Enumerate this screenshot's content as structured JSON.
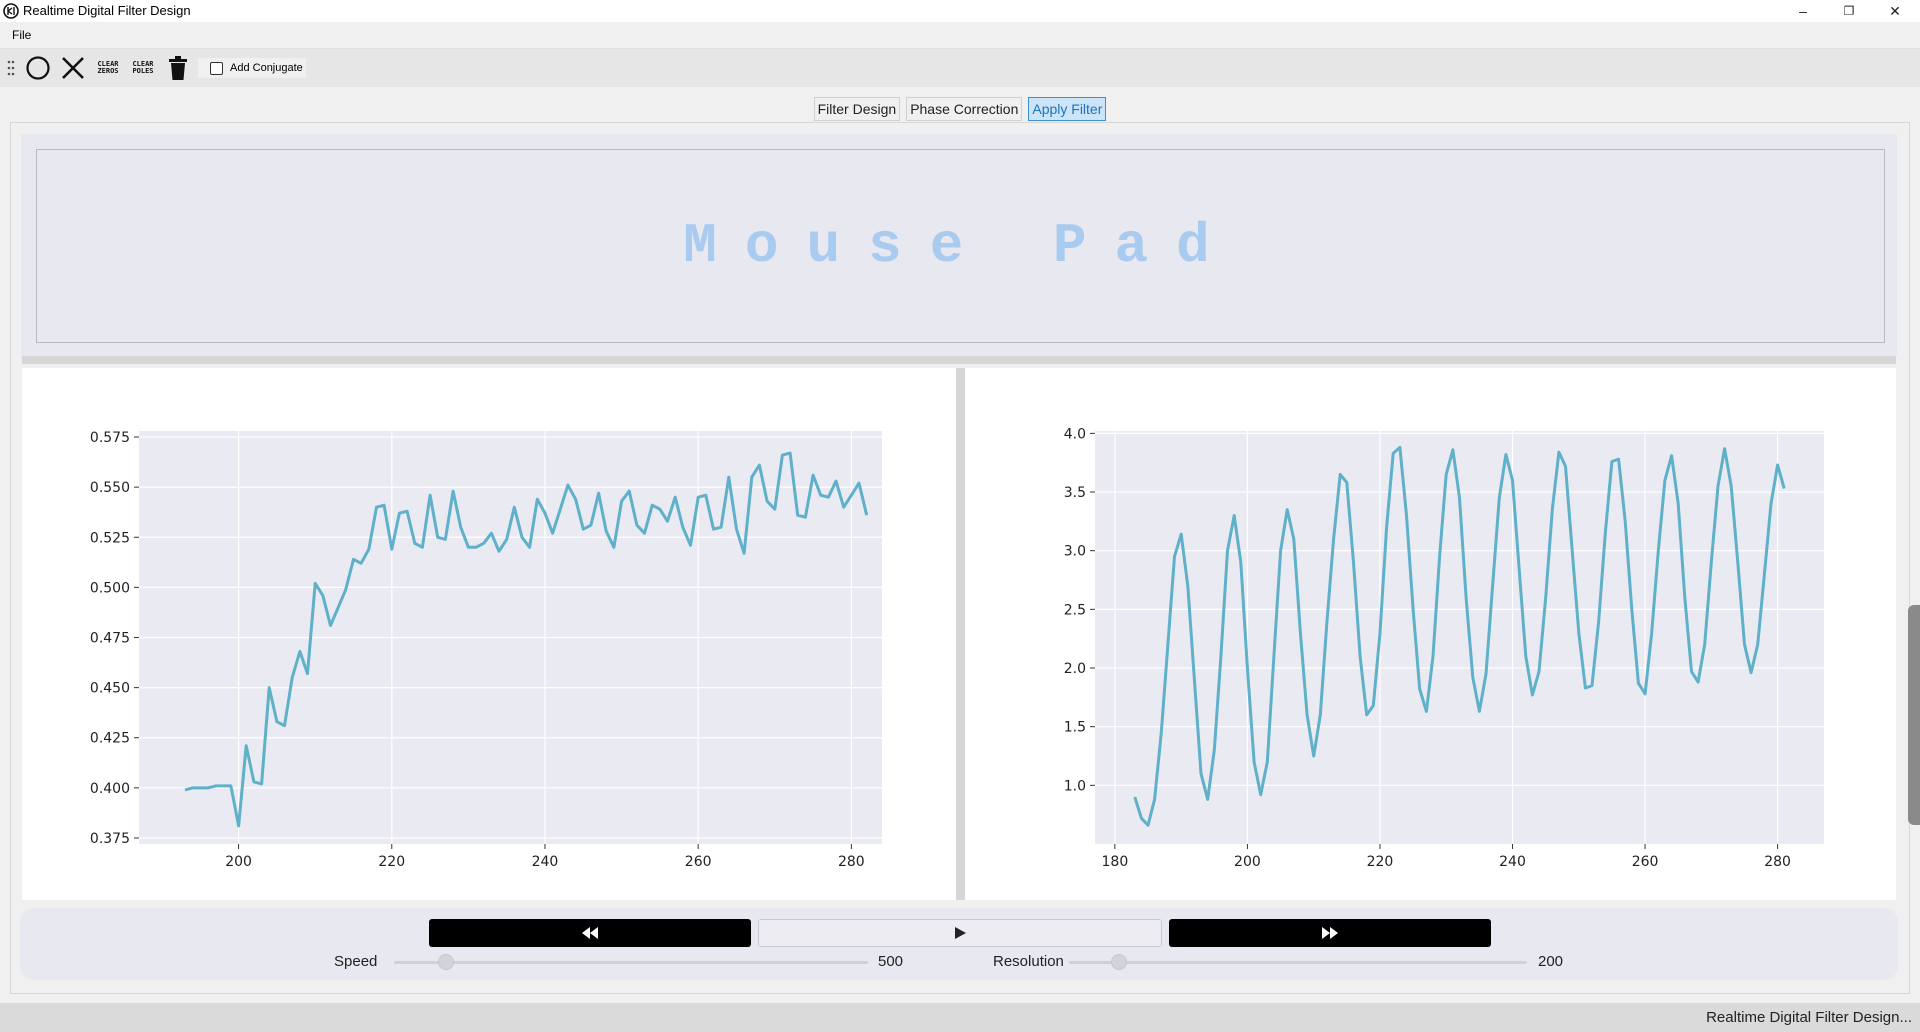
{
  "window": {
    "title": "Realtime Digital Filter Design",
    "minimize_glyph": "–",
    "restore_glyph": "❐",
    "close_glyph": "✕"
  },
  "menu": {
    "file": "File"
  },
  "toolbar": {
    "clear_zeros": "CLEAR\nZEROS",
    "clear_poles": "CLEAR\nPOLES",
    "add_conjugate": "Add Conjugate"
  },
  "tabs": [
    {
      "label": "Filter Design",
      "active": false
    },
    {
      "label": "Phase Correction",
      "active": false
    },
    {
      "label": "Apply Filter",
      "active": true
    }
  ],
  "mouse_pad": {
    "label": "Mouse Pad"
  },
  "controls": {
    "speed_label": "Speed",
    "speed_value": "500",
    "speed_fraction": 0.11,
    "resolution_label": "Resolution",
    "resolution_value": "200",
    "resolution_fraction": 0.11
  },
  "status": {
    "text": "Realtime Digital Filter Design..."
  },
  "colors": {
    "line": "#5fb0c9",
    "plot_bg": "#eaeaf2",
    "grid": "#ffffff",
    "active_tab": "#cce4f7"
  },
  "chart_data": [
    {
      "type": "line",
      "title": "",
      "xlabel": "",
      "ylabel": "",
      "xlim": [
        187,
        284
      ],
      "ylim": [
        0.372,
        0.578
      ],
      "xticks": [
        200,
        220,
        240,
        260,
        280
      ],
      "yticks": [
        0.375,
        0.4,
        0.425,
        0.45,
        0.475,
        0.5,
        0.525,
        0.55,
        0.575
      ],
      "ytick_labels": [
        "0.375",
        "0.400",
        "0.425",
        "0.450",
        "0.475",
        "0.500",
        "0.525",
        "0.550",
        "0.575"
      ],
      "grid": true,
      "series": [
        {
          "x": [
            193,
            194,
            195,
            196,
            197,
            198,
            199,
            200,
            201,
            202,
            203,
            204,
            205,
            206,
            207,
            208,
            209,
            210,
            211,
            212,
            213,
            214,
            215,
            216,
            217,
            218,
            219,
            220,
            221,
            222,
            223,
            224,
            225,
            226,
            227,
            228,
            229,
            230,
            231,
            232,
            233,
            234,
            235,
            236,
            237,
            238,
            239,
            240,
            241,
            242,
            243,
            244,
            245,
            246,
            247,
            248,
            249,
            250,
            251,
            252,
            253,
            254,
            255,
            256,
            257,
            258,
            259,
            260,
            261,
            262,
            263,
            264,
            265,
            266,
            267,
            268,
            269,
            270,
            271,
            272,
            273,
            274,
            275,
            276,
            277,
            278,
            279,
            280,
            281,
            282
          ],
          "y": [
            0.399,
            0.4,
            0.4,
            0.4,
            0.401,
            0.401,
            0.401,
            0.381,
            0.421,
            0.403,
            0.402,
            0.45,
            0.433,
            0.431,
            0.455,
            0.468,
            0.457,
            0.502,
            0.496,
            0.481,
            0.49,
            0.499,
            0.514,
            0.512,
            0.519,
            0.54,
            0.541,
            0.519,
            0.537,
            0.538,
            0.522,
            0.52,
            0.546,
            0.525,
            0.524,
            0.548,
            0.53,
            0.52,
            0.52,
            0.522,
            0.527,
            0.518,
            0.524,
            0.54,
            0.525,
            0.52,
            0.544,
            0.537,
            0.527,
            0.539,
            0.551,
            0.544,
            0.529,
            0.531,
            0.547,
            0.528,
            0.52,
            0.543,
            0.548,
            0.531,
            0.527,
            0.541,
            0.539,
            0.533,
            0.545,
            0.53,
            0.521,
            0.545,
            0.546,
            0.529,
            0.53,
            0.555,
            0.529,
            0.517,
            0.555,
            0.561,
            0.543,
            0.539,
            0.566,
            0.567,
            0.536,
            0.535,
            0.556,
            0.546,
            0.545,
            0.553,
            0.54,
            0.546,
            0.552,
            0.536
          ]
        }
      ]
    },
    {
      "type": "line",
      "title": "",
      "xlabel": "",
      "ylabel": "",
      "xlim": [
        177,
        287
      ],
      "ylim": [
        0.5,
        4.02
      ],
      "xticks": [
        180,
        200,
        220,
        240,
        260,
        280
      ],
      "yticks": [
        1.0,
        1.5,
        2.0,
        2.5,
        3.0,
        3.5,
        4.0
      ],
      "ytick_labels": [
        "1.0",
        "1.5",
        "2.0",
        "2.5",
        "3.0",
        "3.5",
        "4.0"
      ],
      "grid": true,
      "series": [
        {
          "x": [
            183,
            184,
            185,
            186,
            187,
            188,
            189,
            190,
            191,
            192,
            193,
            194,
            195,
            196,
            197,
            198,
            199,
            200,
            201,
            202,
            203,
            204,
            205,
            206,
            207,
            208,
            209,
            210,
            211,
            212,
            213,
            214,
            215,
            216,
            217,
            218,
            219,
            220,
            221,
            222,
            223,
            224,
            225,
            226,
            227,
            228,
            229,
            230,
            231,
            232,
            233,
            234,
            235,
            236,
            237,
            238,
            239,
            240,
            241,
            242,
            243,
            244,
            245,
            246,
            247,
            248,
            249,
            250,
            251,
            252,
            253,
            254,
            255,
            256,
            257,
            258,
            259,
            260,
            261,
            262,
            263,
            264,
            265,
            266,
            267,
            268,
            269,
            270,
            271,
            272,
            273,
            274,
            275,
            276,
            277,
            278,
            279,
            280,
            281
          ],
          "y": [
            0.9,
            0.72,
            0.66,
            0.88,
            1.45,
            2.2,
            2.95,
            3.14,
            2.7,
            1.9,
            1.1,
            0.88,
            1.3,
            2.1,
            3.0,
            3.3,
            2.9,
            2.0,
            1.2,
            0.92,
            1.2,
            2.1,
            3.0,
            3.35,
            3.1,
            2.3,
            1.6,
            1.25,
            1.6,
            2.4,
            3.1,
            3.65,
            3.58,
            2.9,
            2.1,
            1.6,
            1.68,
            2.3,
            3.2,
            3.83,
            3.88,
            3.3,
            2.5,
            1.82,
            1.63,
            2.1,
            2.95,
            3.65,
            3.86,
            3.45,
            2.6,
            1.92,
            1.63,
            1.95,
            2.7,
            3.45,
            3.82,
            3.6,
            2.85,
            2.1,
            1.77,
            1.97,
            2.6,
            3.35,
            3.84,
            3.72,
            3.0,
            2.3,
            1.83,
            1.85,
            2.4,
            3.15,
            3.76,
            3.78,
            3.25,
            2.5,
            1.87,
            1.78,
            2.3,
            3.0,
            3.6,
            3.81,
            3.4,
            2.6,
            1.97,
            1.88,
            2.2,
            2.9,
            3.55,
            3.87,
            3.55,
            2.9,
            2.2,
            1.96,
            2.2,
            2.8,
            3.4,
            3.73,
            3.53
          ]
        }
      ]
    }
  ]
}
